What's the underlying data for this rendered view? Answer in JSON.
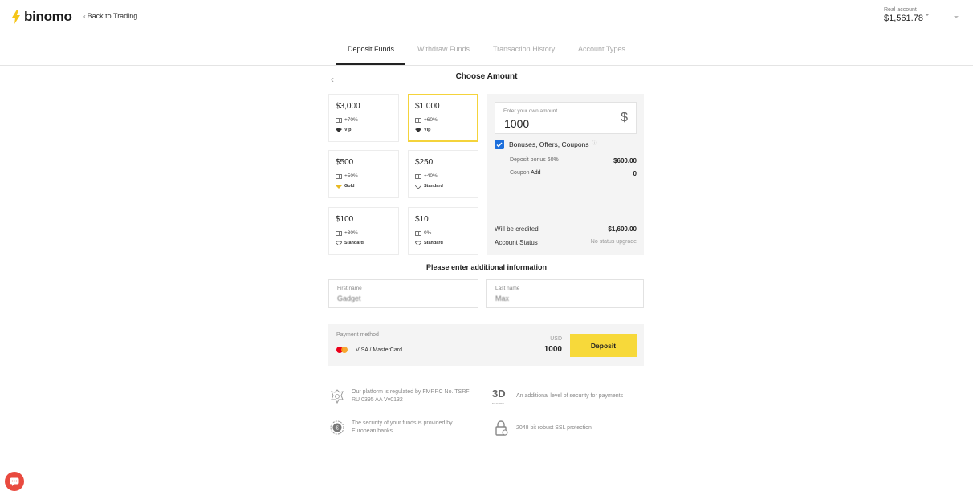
{
  "header": {
    "logo_text": "binomo",
    "back_link": "Back to Trading",
    "account_type": "Real account",
    "account_balance": "$1,561.78"
  },
  "tabs": [
    {
      "label": "Deposit Funds",
      "active": true
    },
    {
      "label": "Withdraw Funds",
      "active": false
    },
    {
      "label": "Transaction History",
      "active": false
    },
    {
      "label": "Account Types",
      "active": false
    }
  ],
  "page_title": "Choose Amount",
  "amounts": [
    {
      "amount": "$3,000",
      "bonus": "+70%",
      "status": "Vip",
      "selected": false
    },
    {
      "amount": "$1,000",
      "bonus": "+60%",
      "status": "Vip",
      "selected": true
    },
    {
      "amount": "$500",
      "bonus": "+50%",
      "status": "Gold",
      "selected": false
    },
    {
      "amount": "$250",
      "bonus": "+40%",
      "status": "Standard",
      "selected": false
    },
    {
      "amount": "$100",
      "bonus": "+30%",
      "status": "Standard",
      "selected": false
    },
    {
      "amount": "$10",
      "bonus": "0%",
      "status": "Standard",
      "selected": false
    }
  ],
  "summary": {
    "own_amount_label": "Enter your own amount",
    "own_amount_value": "1000",
    "currency_symbol": "$",
    "bonuses_label": "Bonuses, Offers, Coupons",
    "bonuses_checked": true,
    "deposit_bonus_label": "Deposit bonus 60%",
    "deposit_bonus_value": "$600.00",
    "coupon_label": "Coupon",
    "coupon_add": "Add",
    "coupon_value": "0",
    "credited_label": "Will be credited",
    "credited_value": "$1,600.00",
    "status_label": "Account Status",
    "status_value": "No status upgrade"
  },
  "additional_info": {
    "title": "Please enter additional information",
    "first_name_label": "First name",
    "first_name_value": "Gadget",
    "last_name_label": "Last name",
    "last_name_value": "Max"
  },
  "payment": {
    "label": "Payment method",
    "method": "VISA / MasterCard",
    "currency": "USD",
    "amount": "1000",
    "deposit_button": "Deposit"
  },
  "security": {
    "regulation": "Our platform is regulated by FMRRC No. TSRF RU 0395 AA Vv0132",
    "three_d_title": "3D",
    "three_d_sub": "SECURE",
    "three_d": "An additional level of security for payments",
    "banks": "The security of your funds is provided by European banks",
    "ssl": "2048 bit robust SSL protection"
  },
  "colors": {
    "brand_yellow": "#f7d93a",
    "selected_border": "#f4d33b",
    "checkbox_blue": "#1d6fdc",
    "chat_red": "#e94a3f"
  }
}
